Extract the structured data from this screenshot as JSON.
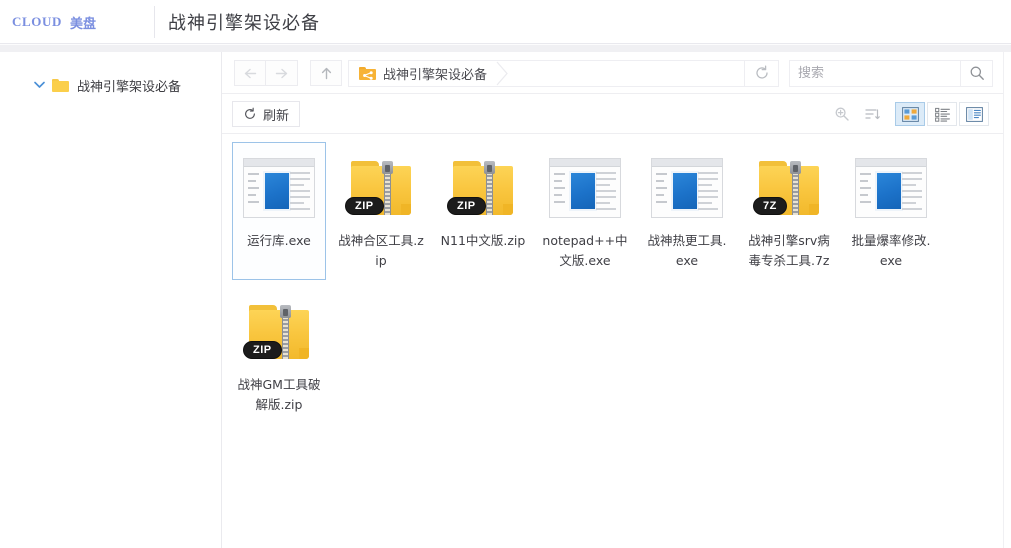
{
  "header": {
    "brand_cloud": "CLOUD",
    "brand_cn": "美盘",
    "page_title": "战神引擎架设必备"
  },
  "sidebar": {
    "tree": [
      {
        "label": "战神引擎架设必备",
        "expanded": true,
        "icon": "folder-icon"
      }
    ]
  },
  "navbar": {
    "back_label": "",
    "forward_label": "",
    "up_label": "",
    "breadcrumb": [
      {
        "label": "战神引擎架设必备",
        "icon": "shared-folder-icon"
      }
    ],
    "refresh_icon": "refresh-icon",
    "search": {
      "value": "",
      "placeholder": "搜索",
      "dropdown_icon": "chevron-down-icon",
      "search_icon": "search-icon"
    }
  },
  "toolbar": {
    "refresh_label": "刷新",
    "view_tools": [
      {
        "name": "zoom-in-icon",
        "active": false
      },
      {
        "name": "sort-icon",
        "active": false
      },
      {
        "name": "grid-view-icon",
        "active": true
      },
      {
        "name": "list-view-icon",
        "active": false
      },
      {
        "name": "detail-view-icon",
        "active": false
      }
    ]
  },
  "files": [
    {
      "name": "运行库.exe",
      "type": "exe",
      "badge": "",
      "selected": true
    },
    {
      "name": "战神合区工具.zip",
      "type": "archive",
      "badge": "ZIP",
      "selected": false
    },
    {
      "name": "N11中文版.zip",
      "type": "archive",
      "badge": "ZIP",
      "selected": false
    },
    {
      "name": "notepad++中文版.exe",
      "type": "exe",
      "badge": "",
      "selected": false
    },
    {
      "name": "战神热更工具.exe",
      "type": "exe",
      "badge": "",
      "selected": false
    },
    {
      "name": "战神引擎srv病毒专杀工具.7z",
      "type": "archive",
      "badge": "7Z",
      "selected": false
    },
    {
      "name": "批量爆率修改.exe",
      "type": "exe",
      "badge": "",
      "selected": false
    },
    {
      "name": "战神GM工具破解版.zip",
      "type": "archive",
      "badge": "ZIP",
      "selected": false
    }
  ],
  "colors": {
    "brand": "#7b8fe0",
    "folder": "#fbcf4b",
    "selection_border": "#9cc3e8",
    "active_view_bg": "#dcebf8",
    "exe_blue": "#1c72c9"
  }
}
